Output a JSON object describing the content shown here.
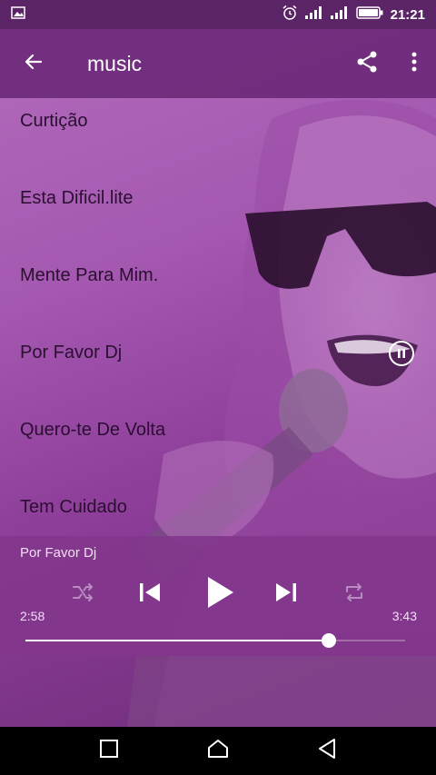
{
  "status_bar": {
    "time": "21:21",
    "icons": [
      "image-icon",
      "alarm-icon",
      "signal-icon",
      "signal-icon-2",
      "battery-icon"
    ]
  },
  "app_bar": {
    "title": "music",
    "back_icon": "arrow-left-icon",
    "share_icon": "share-icon",
    "more_icon": "more-vertical-icon"
  },
  "songs": [
    {
      "title": "Curtição"
    },
    {
      "title": "Esta Dificil.lite"
    },
    {
      "title": "Mente Para Mim."
    },
    {
      "title": "Por Favor Dj",
      "playing": true
    },
    {
      "title": "Quero-te De Volta"
    },
    {
      "title": "Tem Cuidado"
    }
  ],
  "player": {
    "now_playing": "Por Favor Dj",
    "current_time": "2:58",
    "total_time": "3:43",
    "progress": 0.8,
    "icons": [
      "shuffle-icon",
      "skip-previous-icon",
      "play-icon",
      "skip-next-icon",
      "repeat-icon"
    ]
  },
  "nav_bar": {
    "icons": [
      "recents-square-icon",
      "home-icon",
      "back-triangle-icon"
    ]
  },
  "colors": {
    "app_bar": "#6e2a7a",
    "player": "#82378c",
    "list_text": "#2a0f30",
    "accent": "#ffffff"
  }
}
